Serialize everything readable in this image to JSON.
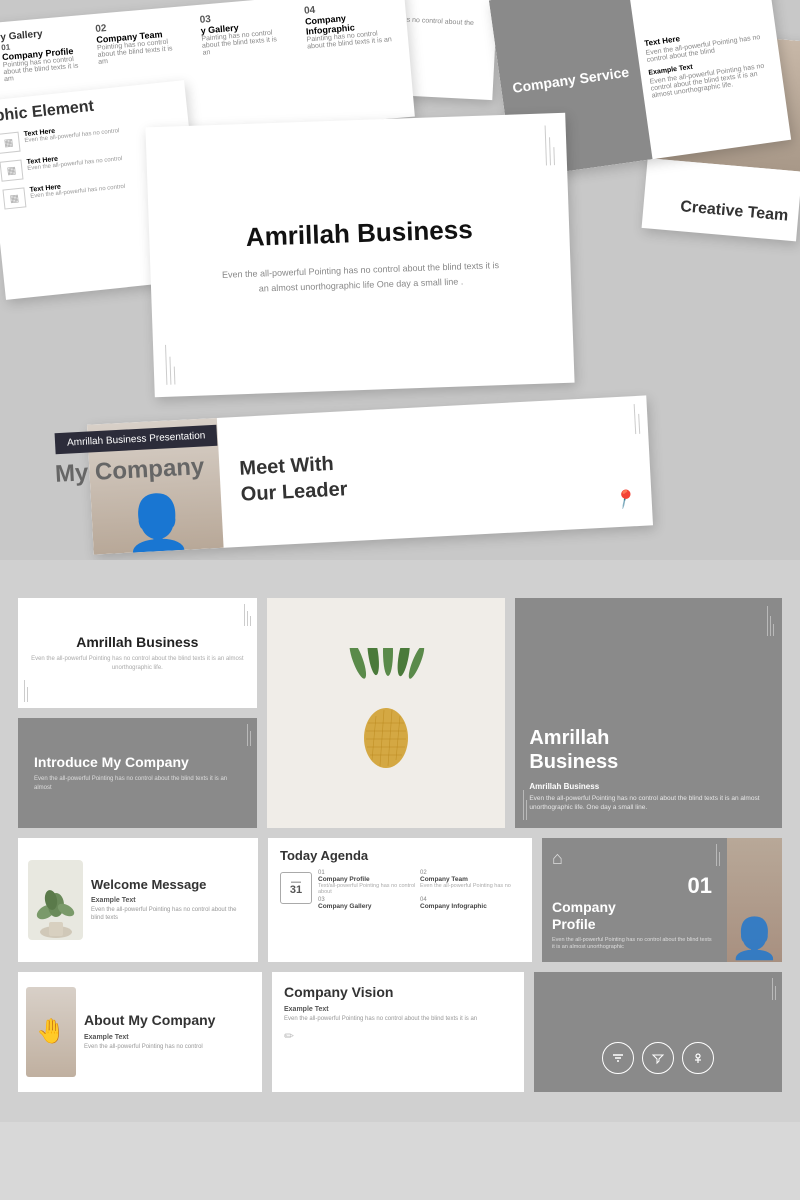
{
  "app": {
    "title": "Amrillah Business Presentation"
  },
  "top_section": {
    "label": "Amrillah Presentation",
    "my_company": "My Company",
    "main_title": "Amrillah Business",
    "main_subtitle": "Even the all-powerful Pointing has no control about the blind texts it is an almost unorthographic life One day a small line .",
    "service_title": "Company Service",
    "service_text": "Text Here",
    "service_example": "Example Text",
    "service_body": "Even the all-powerful Pointing has no control about the blind texts it is an almost unorthographic life.",
    "team_item1_num": "02",
    "team_item1_label": "Company Team",
    "team_item1_text": "Pointing has no control about the blind texts it is am",
    "team_item2_num": "04",
    "team_item2_label": "Company Infographic",
    "team_item2_text": "Painting has no control about the blind texts it is an",
    "gallery_num": "03",
    "gallery_label": "y Gallery",
    "graphic_title": "phic Element",
    "leader_title": "Meet With\nOur Leader",
    "creative_title": "Creative\nTeam",
    "topright_text": "Text Here",
    "topright_body": "Even the all-powerful Pointing has no control about the blind texts it is am"
  },
  "bottom_section": {
    "row1": {
      "slide1_title": "Amrillah Business",
      "slide1_subtitle": "Even the all-powerful Pointing has no control about the blind texts it is an almost unorthographic life.",
      "slide2_title": "Amrillah\nBusiness",
      "slide2_example": "Example Text",
      "slide2_body": "Even the all-powerful Pointing has no control about the blind texts it is an almost unorthographic life. One day a small line."
    },
    "row2": {
      "slide1_title": "Introduce My Company",
      "slide1_body": "Even the all-powerful Pointing has no control about the blind texts it is an almost"
    },
    "row3": {
      "welcome_title": "Welcome\nMessage",
      "welcome_example": "Example Text",
      "welcome_body": "Even the all-powerful Pointing has no control about the blind texts",
      "agenda_title": "Today\nAgenda",
      "agenda_item1_num": "01",
      "agenda_item1_label": "Company Profile",
      "agenda_item1_text": "Text/all-powerful Pointing has no control about",
      "agenda_item2_num": "02",
      "agenda_item2_label": "Company Team",
      "agenda_item2_text": "Even the all-powerful Pointing has no",
      "agenda_item3_num": "03",
      "agenda_item3_label": "Company Gallery",
      "agenda_item4_num": "04",
      "agenda_item4_label": "Company Infographic",
      "agenda_date": "31",
      "profile_num": "01",
      "profile_title": "Company Profile",
      "profile_body": "Even the all-powerful Pointing has no control about the blind texts it is an almost unorthographic"
    },
    "row4": {
      "about_title": "About\nMy Company",
      "about_example": "Example Text",
      "about_body": "Even the all-powerful Pointing has no control",
      "vision_title": "Company\nVision",
      "vision_example": "Example Text",
      "vision_body": "Even the all-powerful Pointing has no control about the blind texts it is an",
      "service_label1": "filter",
      "service_label2": "filter-outline",
      "service_label3": "filter-alt"
    }
  }
}
